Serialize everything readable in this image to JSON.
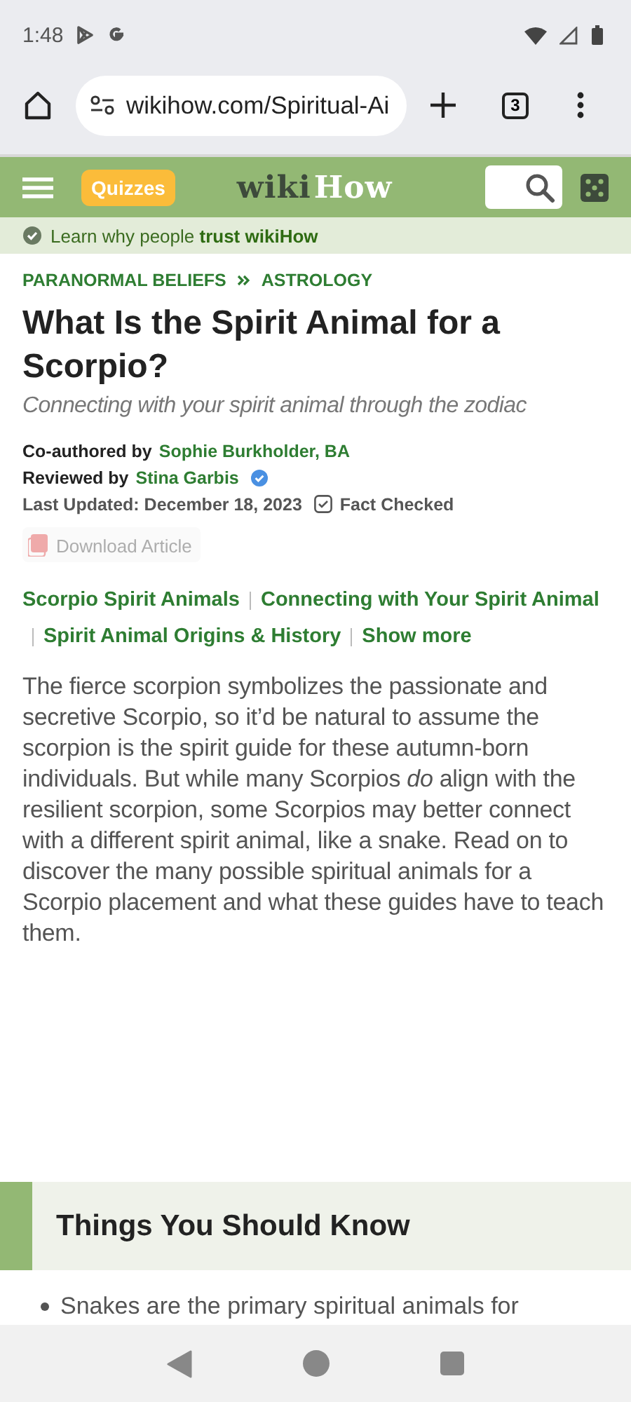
{
  "status_bar": {
    "time": "1:48"
  },
  "browser": {
    "url": "wikihow.com/Spiritual-Ai",
    "tab_count": "3"
  },
  "site_header": {
    "quizzes_label": "Quizzes",
    "logo_parts": [
      "wiki",
      "How"
    ]
  },
  "trust_bar": {
    "text": "Learn why people **trust wikiHow**"
  },
  "breadcrumbs": [
    "PARANORMAL BELIEFS",
    "ASTROLOGY"
  ],
  "article": {
    "title": "What Is the Spirit Animal for a Scorpio?",
    "subtitle": "Connecting with your spirit animal through the zodiac",
    "coauthor_label": "Co-authored by",
    "coauthor": "Sophie Burkholder, BA",
    "reviewer_label": "Reviewed by",
    "reviewer": "Stina Garbis",
    "reviewer_verified": true,
    "last_updated": "Last Updated: December 18, 2023",
    "fact_checked_label": "Fact Checked",
    "download": {
      "label": "Download Article",
      "disabled": true
    },
    "toc": [
      "Scorpio Spirit Animals",
      "Connecting with Your Spirit Animal",
      "Spirit Animal Origins & History",
      "Show more"
    ],
    "intro": "The fierce scorpion symbolizes the passionate and secretive Scorpio, so it’d be natural to assume the scorpion is the spirit guide for these autumn-born individuals. But while many Scorpios *do* align with the resilient scorpion, some Scorpios may better connect with a different spirit animal, like a snake. Read on to discover the many possible spiritual animals for a Scorpio placement and what these guides have to teach them.",
    "section_title": "Things You Should Know",
    "bullets": [
      "Snakes are the primary spiritual animals for"
    ]
  }
}
